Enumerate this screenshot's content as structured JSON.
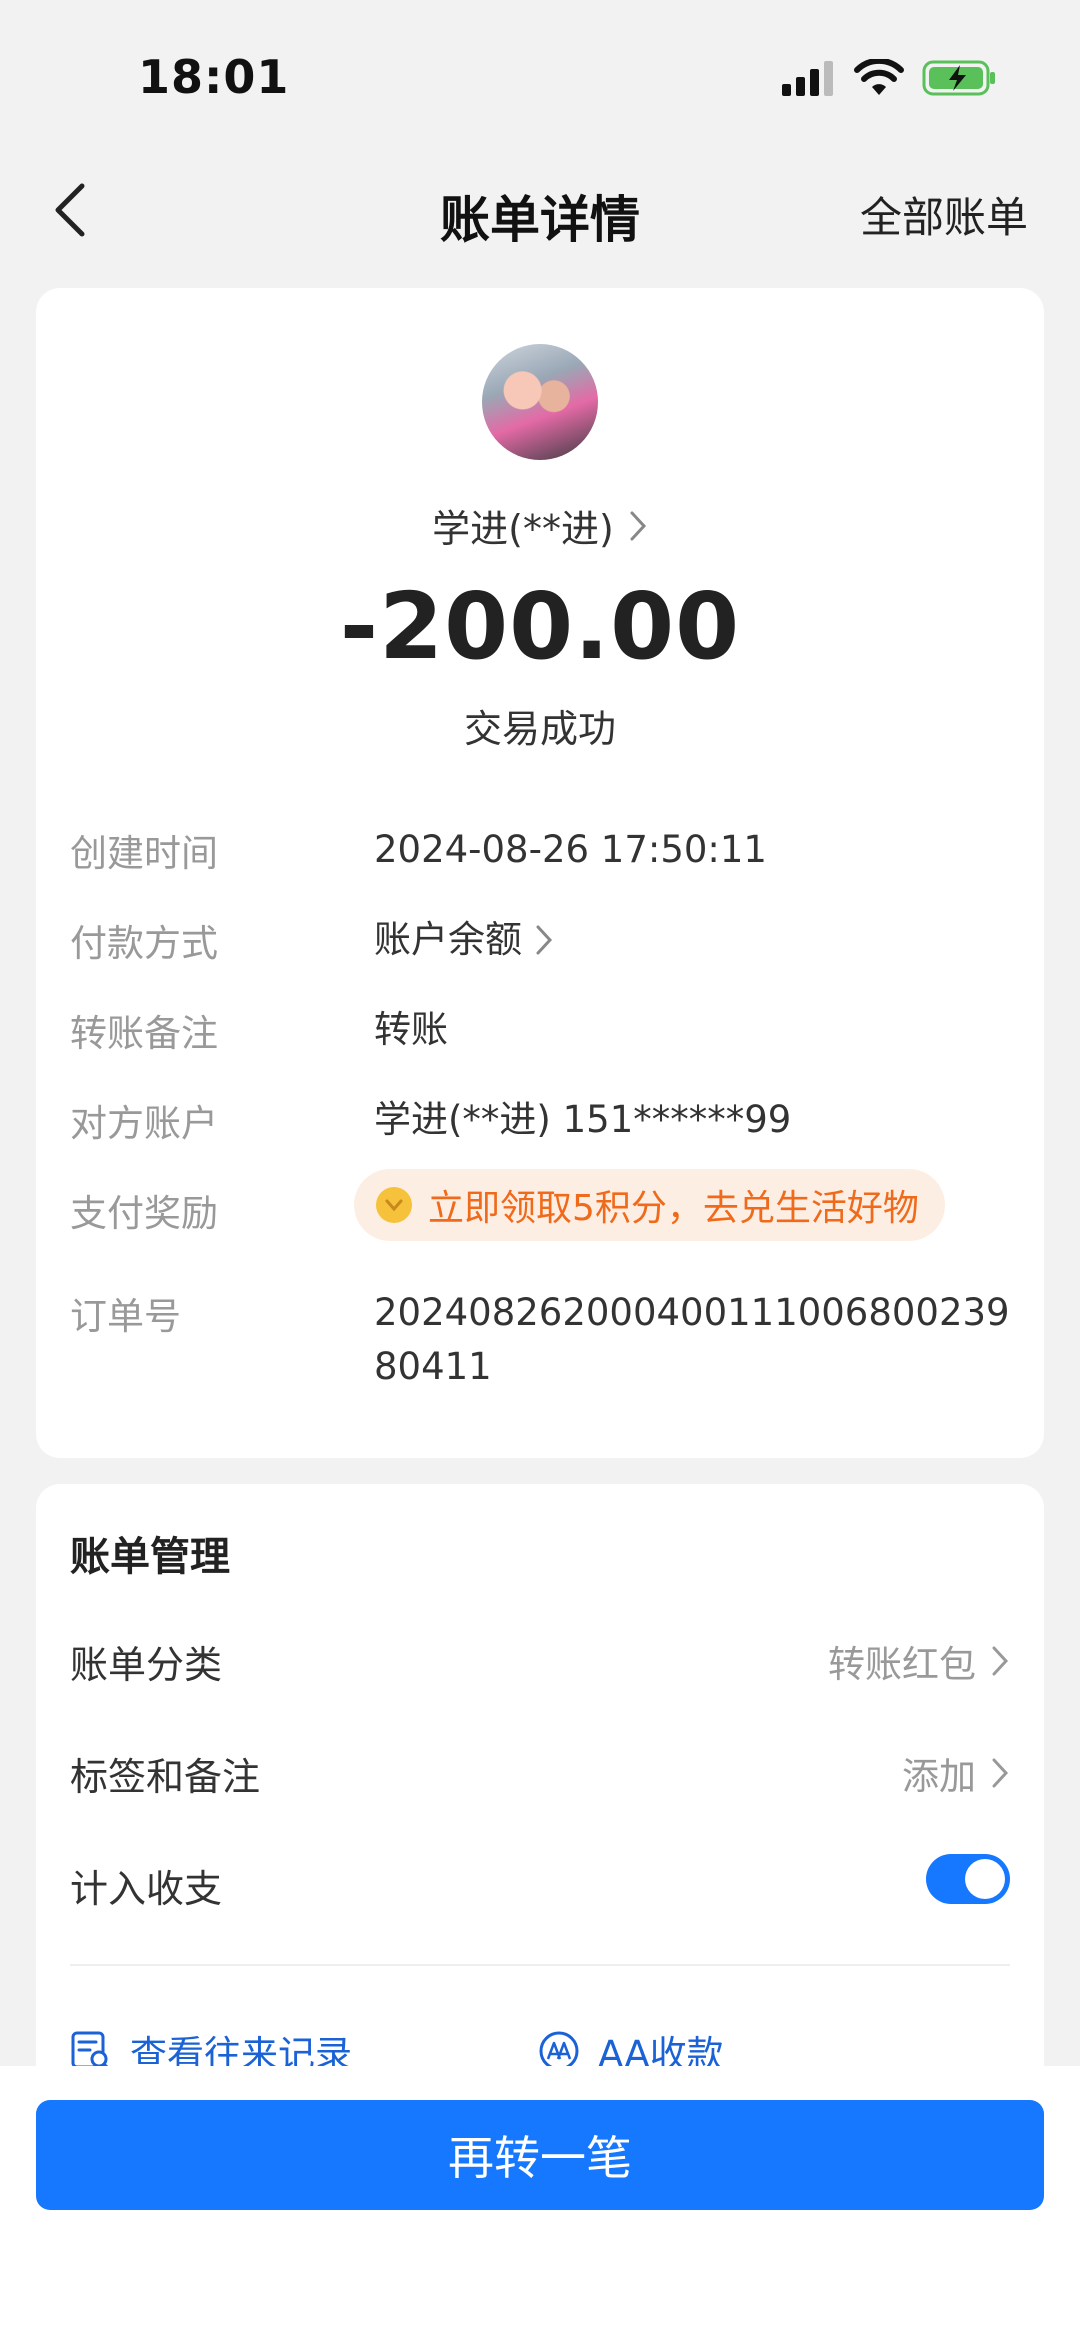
{
  "status_bar": {
    "time": "18:01"
  },
  "nav": {
    "title": "账单详情",
    "right_label": "全部账单"
  },
  "transaction": {
    "payee_name": "学进(**进)",
    "amount": "-200.00",
    "status": "交易成功"
  },
  "details": [
    {
      "label": "创建时间",
      "value": "2024-08-26 17:50:11"
    },
    {
      "label": "付款方式",
      "value": "账户余额"
    },
    {
      "label": "转账备注",
      "value": "转账"
    },
    {
      "label": "对方账户",
      "value": "学进(**进) 151******99"
    },
    {
      "label": "支付奖励",
      "value": "立即领取5积分，去兑生活好物"
    },
    {
      "label": "订单号",
      "value": "20240826200040011100680023980411"
    }
  ],
  "management": {
    "title": "账单管理",
    "category_label": "账单分类",
    "category_value": "转账红包",
    "tags_label": "标签和备注",
    "tags_value": "添加",
    "include_label": "计入收支",
    "include_enabled": true
  },
  "actions": {
    "history_label": "查看往来记录",
    "aa_label": "AA收款"
  },
  "bottom": {
    "button_label": "再转一笔"
  },
  "colors": {
    "accent": "#1677ff",
    "reward_text": "#f06a1b",
    "reward_bg": "#fdeee3"
  }
}
